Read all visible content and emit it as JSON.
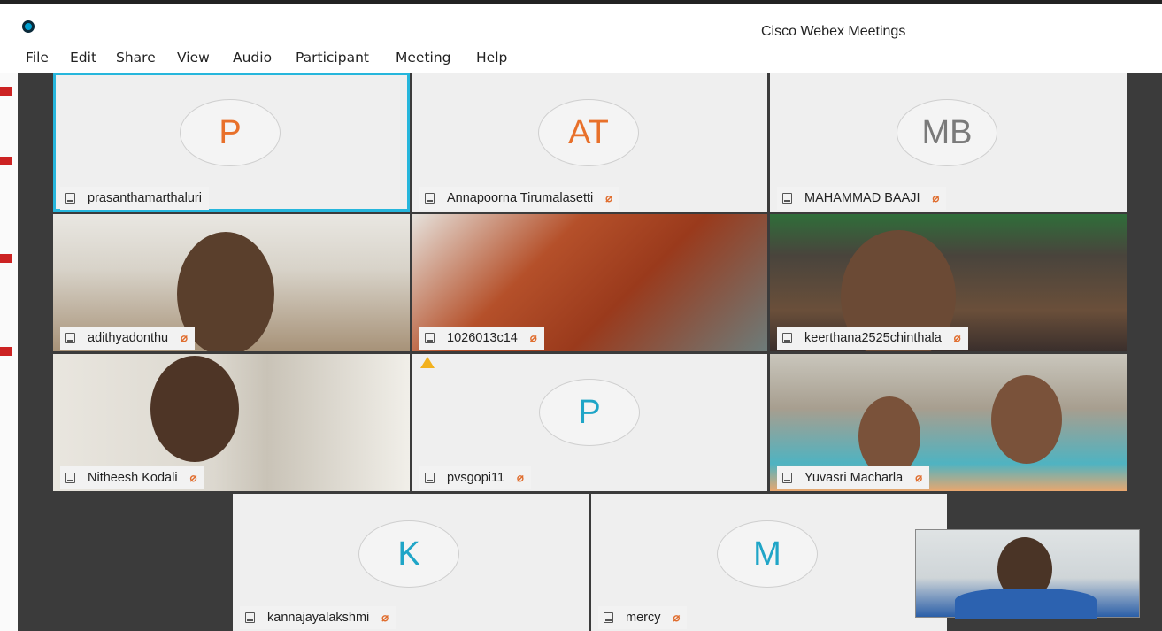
{
  "window": {
    "title": "Cisco Webex Meetings"
  },
  "menu": [
    "File",
    "Edit",
    "Share",
    "View",
    "Audio",
    "Participant",
    "Meeting",
    "Help"
  ],
  "participants": [
    {
      "name": "prasanthamarthaluri",
      "initials": "P",
      "initials_color": "#e8702a",
      "muted": false,
      "active": true
    },
    {
      "name": "Annapoorna Tirumalasetti",
      "initials": "AT",
      "initials_color": "#e8702a",
      "muted": true
    },
    {
      "name": "MAHAMMAD BAAJI",
      "initials": "MB",
      "initials_color": "#7a7a7a",
      "muted": true
    },
    {
      "name": "adithyadonthu",
      "video": true,
      "muted": true
    },
    {
      "name": "1026013c14",
      "video": true,
      "muted": true
    },
    {
      "name": "keerthana2525chinthala",
      "video": true,
      "muted": true
    },
    {
      "name": "Nitheesh Kodali",
      "video": true,
      "muted": true
    },
    {
      "name": "pvsgopi11",
      "initials": "P",
      "initials_color": "#1fa5c7",
      "muted": true,
      "warning": true
    },
    {
      "name": "Yuvasri Macharla",
      "video": true,
      "muted": true
    },
    {
      "name": "kannajayalakshmi",
      "initials": "K",
      "initials_color": "#1fa5c7",
      "muted": true
    },
    {
      "name": "mercy",
      "initials": "M",
      "initials_color": "#1fa5c7",
      "muted": true
    }
  ],
  "icons": {
    "mute": "mic-muted-icon",
    "device": "device-icon",
    "warning": "warning-icon"
  }
}
